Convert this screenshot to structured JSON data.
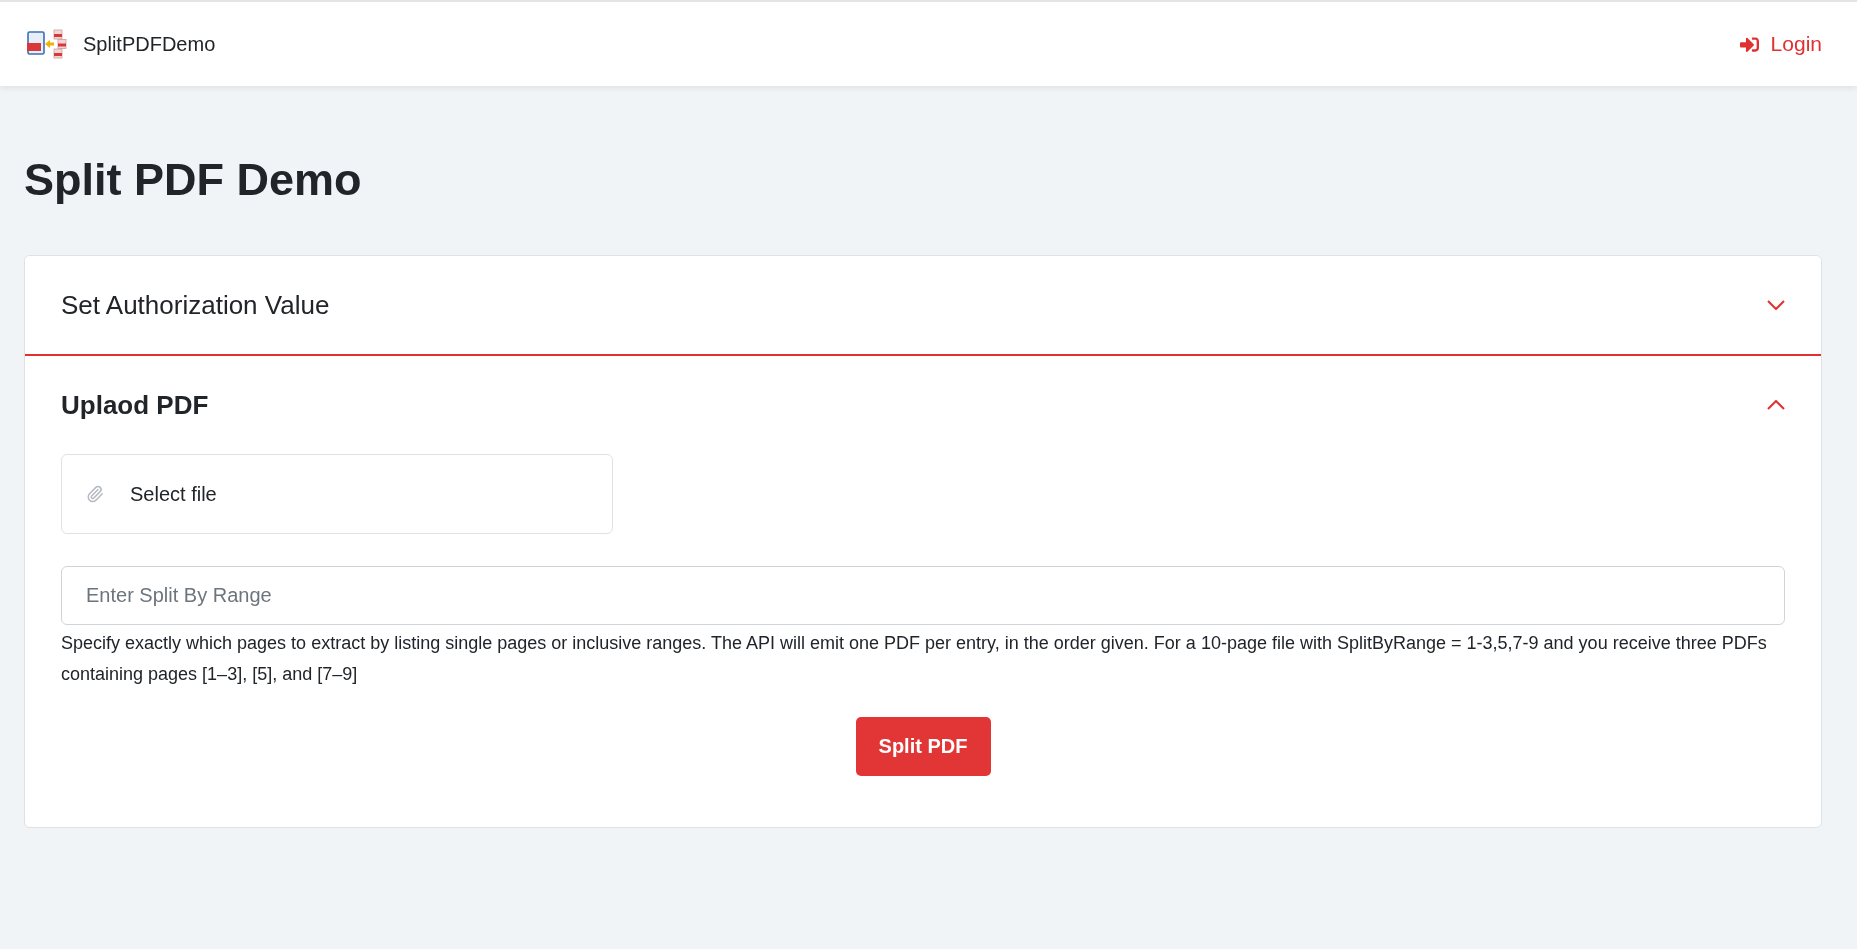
{
  "navbar": {
    "brand": "SplitPDFDemo",
    "login_link": "Login"
  },
  "page_title": "Split PDF Demo",
  "accordion": [
    {
      "title": "Set Authorization Value",
      "expanded": false
    },
    {
      "title": "Uplaod PDF",
      "expanded": true,
      "file_picker": {
        "label": "Select file"
      },
      "range_field": {
        "placeholder": "Enter Split By Range"
      },
      "help_text": "Specify exactly which pages to extract by listing single pages or inclusive ranges. The API will emit one PDF per entry, in the order given. For a 10-page file with SplitByRange = 1-3,5,7-9 and you receive three PDFs containing pages [1–3], [5], and [7–9]",
      "submit_button": "Split PDF"
    }
  ]
}
